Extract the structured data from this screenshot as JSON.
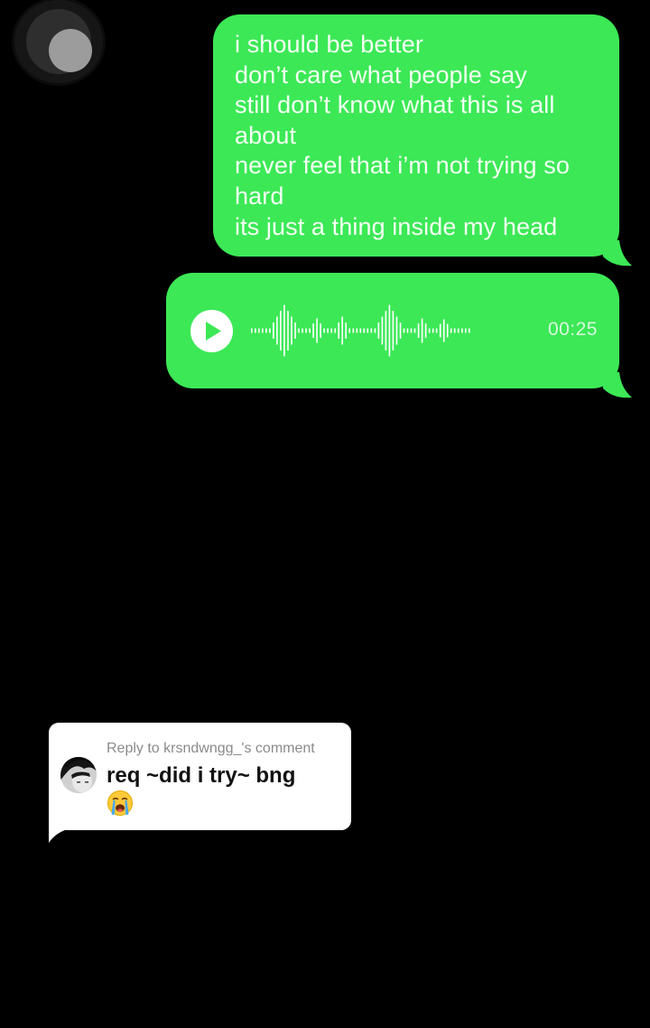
{
  "chat": {
    "message_lines": [
      "i should be better",
      "don’t care what people say",
      "still don’t know what this is all",
      "about",
      "never feel that i’m not trying so",
      "hard",
      "its just a thing inside my head"
    ],
    "voice_note": {
      "duration": "00:25",
      "play_icon": "play-icon"
    }
  },
  "reply": {
    "label": "Reply to krsndwngg_'s comment",
    "text": "req ~did i try~ bng",
    "emoji_icon": "loudly-crying-face-icon"
  },
  "colors": {
    "background": "#000000",
    "bubble_green": "#3ce856",
    "card_white": "#ffffff"
  }
}
